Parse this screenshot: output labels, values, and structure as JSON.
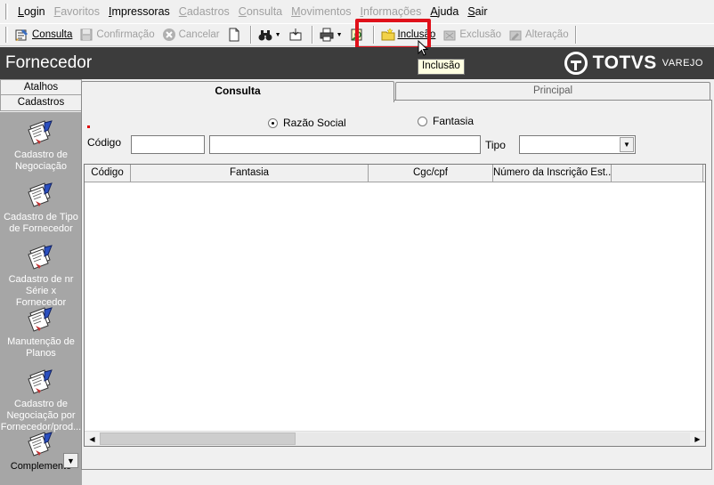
{
  "menu": [
    {
      "label": "Login",
      "ul": "L",
      "rest": "ogin",
      "enabled": true
    },
    {
      "label": "Favoritos",
      "ul": "F",
      "rest": "avoritos",
      "enabled": false
    },
    {
      "label": "Impressoras",
      "ul": "I",
      "rest": "mpressoras",
      "enabled": true
    },
    {
      "label": "Cadastros",
      "ul": "C",
      "rest": "adastros",
      "enabled": false
    },
    {
      "label": "Consulta",
      "ul": "C",
      "rest": "onsulta",
      "enabled": false
    },
    {
      "label": "Movimentos",
      "ul": "M",
      "rest": "ovimentos",
      "enabled": false
    },
    {
      "label": "Informações",
      "ul": "I",
      "rest": "nformações",
      "enabled": false
    },
    {
      "label": "Ajuda",
      "ul": "A",
      "rest": "juda",
      "enabled": true
    },
    {
      "label": "Sair",
      "ul": "S",
      "rest": "air",
      "enabled": true
    }
  ],
  "toolbar": {
    "consulta": "Consulta",
    "confirmacao": "Confirmação",
    "cancelar": "Cancelar",
    "inclusao": "Inclusão",
    "exclusao": "Exclusão",
    "alteracao": "Alteração",
    "tooltip": "Inclusão"
  },
  "window": {
    "title": "Fornecedor",
    "brand": "TOTVS",
    "brand_sub": "VAREJO"
  },
  "sidebar": {
    "tabs": [
      "Atalhos",
      "Cadastros"
    ],
    "items": [
      "Cadastro de Negociação",
      "Cadastro de Tipo de Fornecedor",
      "Cadastro de nr Série x Fornecedor",
      "Manutenção de Planos",
      "Cadastro de Negociação por Fornecedor/prod...",
      "Complemento"
    ]
  },
  "tabs": {
    "consulta": "Consulta",
    "principal": "Principal"
  },
  "search": {
    "radio_razao": "Razão Social",
    "radio_fantasia": "Fantasia",
    "selected": "Razão Social",
    "codigo_label": "Código",
    "codigo_value": "",
    "name_value": "",
    "tipo_label": "Tipo",
    "tipo_value": ""
  },
  "grid": {
    "columns": [
      "Código",
      "Fantasia",
      "Cgc/cpf",
      "Número da Inscrição Est...",
      ""
    ]
  },
  "colors": {
    "title_band": "#3c3c3c",
    "highlight": "#e0101a",
    "sidebar_panel": "#a6a6a6"
  }
}
